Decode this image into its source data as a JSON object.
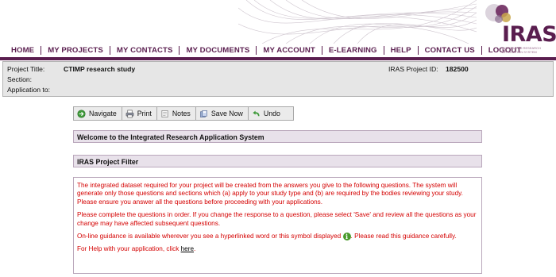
{
  "nav": {
    "items": [
      "HOME",
      "MY PROJECTS",
      "MY CONTACTS",
      "MY DOCUMENTS",
      "MY ACCOUNT",
      "E-LEARNING",
      "HELP",
      "CONTACT US",
      "LOGOUT"
    ]
  },
  "logo": {
    "text": "IRAS",
    "subtitle": "INTEGRATED RESEARCH APPLICATION SYSTEM"
  },
  "project": {
    "title_label": "Project Title:",
    "title_value": "CTIMP research study",
    "section_label": "Section:",
    "application_label": "Application to:",
    "id_label": "IRAS Project ID:",
    "id_value": "182500"
  },
  "toolbar": {
    "navigate": "Navigate",
    "print": "Print",
    "notes": "Notes",
    "save_now": "Save Now",
    "undo": "Undo"
  },
  "panels": {
    "welcome_title": "Welcome to the Integrated Research Application System",
    "filter_title": "IRAS Project Filter"
  },
  "body": {
    "para1": "The integrated dataset required for your project will be created from the answers you give to the following questions. The system will generate only those questions and sections which (a) apply to your study type and (b) are required by the bodies reviewing your study. Please ensure you answer all the questions before proceeding with your applications.",
    "para2": "Please complete the questions in order. If you change the response to a question, please select 'Save' and review all the questions as your change may have affected subsequent questions.",
    "para3_before": "On-line guidance is available wherever you see a hyperlinked word or this symbol displayed",
    "para3_after": ". Please read this guidance carefully.",
    "para4_before": "For Help with your application, click",
    "para4_link": "here",
    "para4_after": "."
  },
  "colors": {
    "brand": "#5a1e4f",
    "body_text": "#d40000",
    "panel_header_bg": "#e8e1ea"
  }
}
